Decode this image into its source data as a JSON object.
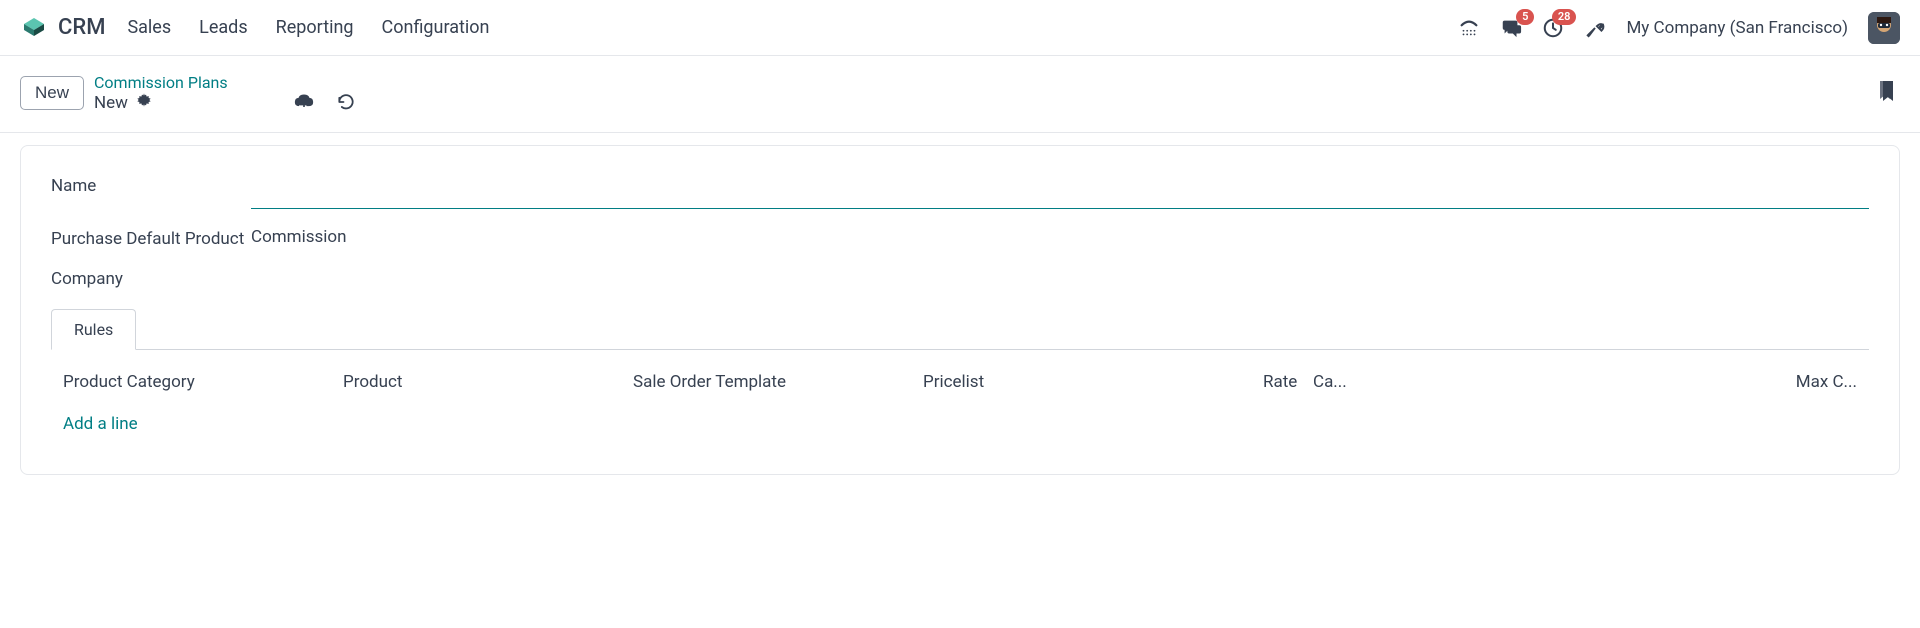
{
  "app": {
    "title": "CRM",
    "nav": [
      "Sales",
      "Leads",
      "Reporting",
      "Configuration"
    ]
  },
  "topright": {
    "messages_badge": "5",
    "activities_badge": "28",
    "company": "My Company (San Francisco)"
  },
  "subheader": {
    "new_button": "New",
    "breadcrumb_parent": "Commission Plans",
    "breadcrumb_current": "New"
  },
  "form": {
    "name_label": "Name",
    "name_value": "",
    "purchase_default_label": "Purchase Default Product",
    "purchase_default_value": "Commission",
    "company_label": "Company",
    "company_value": ""
  },
  "tabs": {
    "rules": "Rules"
  },
  "rules_table": {
    "headers": {
      "product_category": "Product Category",
      "product": "Product",
      "sale_order_template": "Sale Order Template",
      "pricelist": "Pricelist",
      "rate": "Rate",
      "ca": "Ca...",
      "max": "Max C..."
    },
    "add_line": "Add a line"
  }
}
